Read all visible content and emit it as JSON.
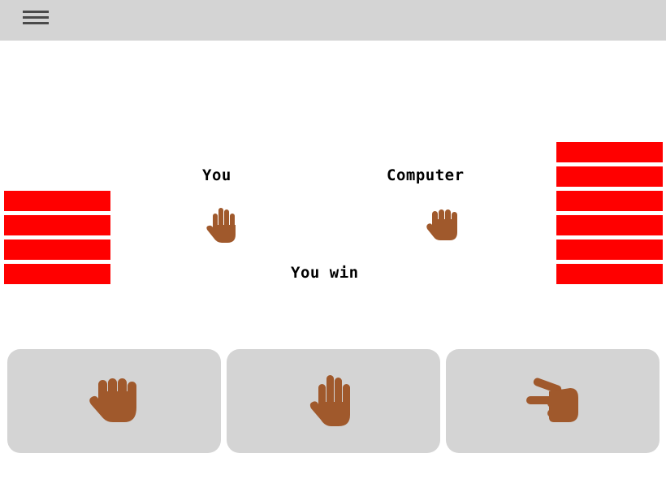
{
  "scoreboard": {
    "player_label": "You",
    "computer_label": "Computer",
    "result_text": "You win",
    "player_lives": 4,
    "computer_lives": 6,
    "life_color": "#ff0000"
  },
  "round": {
    "player_hand": "paper-hand-icon",
    "computer_hand": "rock-hand-icon"
  },
  "choices": [
    {
      "name": "rock",
      "icon": "rock-hand-icon"
    },
    {
      "name": "paper",
      "icon": "paper-hand-icon"
    },
    {
      "name": "scissors",
      "icon": "scissors-hand-icon"
    }
  ],
  "colors": {
    "skin": "#a0592c",
    "topbar": "#d4d4d4",
    "button": "#d4d4d4"
  },
  "menu": {
    "icon": "hamburger-menu-icon"
  }
}
